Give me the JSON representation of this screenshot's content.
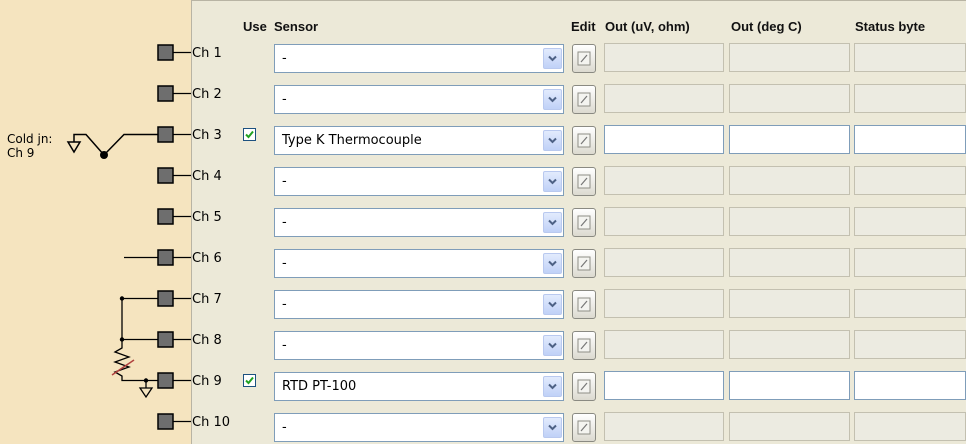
{
  "headers": {
    "use": "Use",
    "sensor": "Sensor",
    "edit": "Edit",
    "out_raw": "Out (uV, ohm)",
    "out_degc": "Out (deg C)",
    "status": "Status byte"
  },
  "cold_junction": {
    "line1": "Cold jn:",
    "line2": "Ch 9"
  },
  "channels": [
    {
      "label": "Ch 1",
      "checked": false,
      "sensor": "-"
    },
    {
      "label": "Ch 2",
      "checked": false,
      "sensor": "-"
    },
    {
      "label": "Ch 3",
      "checked": true,
      "sensor": "Type K Thermocouple"
    },
    {
      "label": "Ch 4",
      "checked": false,
      "sensor": "-"
    },
    {
      "label": "Ch 5",
      "checked": false,
      "sensor": "-"
    },
    {
      "label": "Ch 6",
      "checked": false,
      "sensor": "-"
    },
    {
      "label": "Ch 7",
      "checked": false,
      "sensor": "-"
    },
    {
      "label": "Ch 8",
      "checked": false,
      "sensor": "-"
    },
    {
      "label": "Ch 9",
      "checked": true,
      "sensor": "RTD PT-100"
    },
    {
      "label": "Ch 10",
      "checked": false,
      "sensor": "-"
    }
  ],
  "colors": {
    "diagram_bg": "#f5e4bf",
    "panel_bg": "#ece9d8",
    "check_color": "#21a121",
    "terminal_fill": "#6e6e6e"
  }
}
